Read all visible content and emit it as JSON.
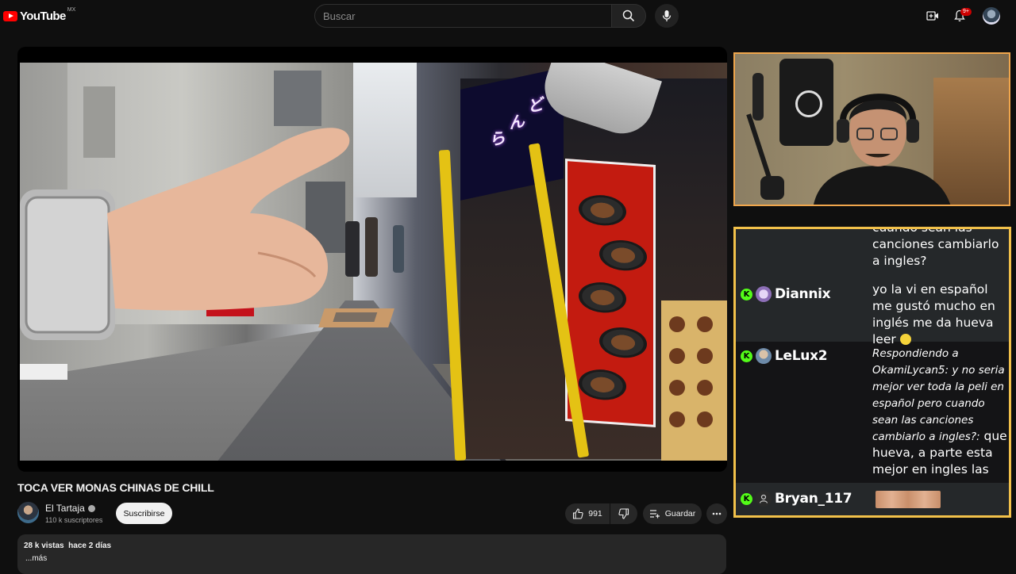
{
  "header": {
    "logo_text": "YouTube",
    "region": "MX",
    "search_placeholder": "Buscar",
    "notification_count": "9+"
  },
  "video": {
    "title": "TOCA VER MONAS CHINAS DE CHILL",
    "channel_name": "El Tartaja",
    "subscribers": "110 k suscriptores",
    "subscribe_label": "Suscribirse",
    "likes": "991",
    "save_label": "Guardar",
    "views": "28 k vistas",
    "date": "hace 2 días",
    "more_label": "...más"
  },
  "chat": {
    "messages": [
      {
        "user": "",
        "text": "cuando sean las canciones cambiarlo a ingles?",
        "shaded": true
      },
      {
        "user": "Diannix",
        "text": "yo la vi en español me gustó mucho en inglés me da hueva leer",
        "shaded": true
      },
      {
        "user": "LeLux2",
        "reply": "Respondiendo a OkamiLycan5: y no seria mejor ver toda la peli en español pero cuando sean las canciones cambiarlo a ingles?:",
        "text": "que hueva, a parte esta mejor en ingles las voces",
        "shaded": false
      },
      {
        "user": "Bryan_117",
        "text": "",
        "shaded": true
      }
    ]
  },
  "colors": {
    "background": "#0f0f0f",
    "webcam_border": "#f0a64c",
    "chat_border": "#f2c14a",
    "kick_green": "#53fc18",
    "youtube_red": "#ff0000"
  },
  "icons": [
    "youtube-logo-icon",
    "search-icon",
    "mic-icon",
    "create-video-icon",
    "bell-icon",
    "like-icon",
    "dislike-icon",
    "save-playlist-icon",
    "more-icon",
    "verified-icon",
    "kick-badge-icon"
  ]
}
